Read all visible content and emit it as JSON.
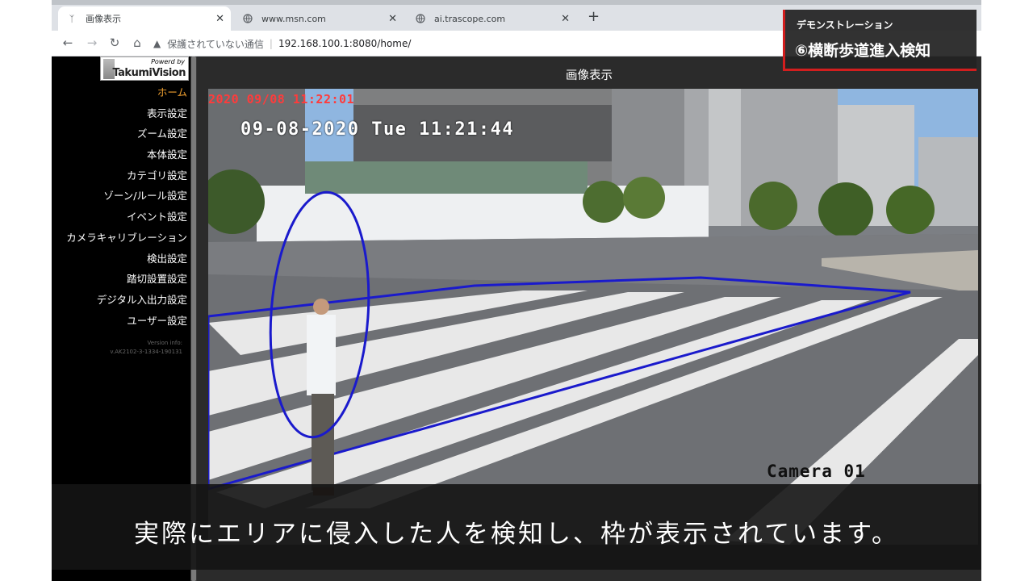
{
  "browser": {
    "tabs": [
      {
        "label": "画像表示",
        "active": true
      },
      {
        "label": "www.msn.com",
        "active": false
      },
      {
        "label": "ai.trascope.com",
        "active": false
      }
    ],
    "insecure_label": "保護されていない通信",
    "url": "192.168.100.1:8080/home/"
  },
  "logo": {
    "power": "Powerd by",
    "brand": "TakumiVision"
  },
  "sidebar": {
    "items": [
      {
        "label": "ホーム"
      },
      {
        "label": "表示設定"
      },
      {
        "label": "ズーム設定"
      },
      {
        "label": "本体設定"
      },
      {
        "label": "カテゴリ設定"
      },
      {
        "label": "ゾーン/ルール設定"
      },
      {
        "label": "イベント設定"
      },
      {
        "label": "カメラキャリブレーション"
      },
      {
        "label": "検出設定"
      },
      {
        "label": "踏切設置設定"
      },
      {
        "label": "デジタル入出力設定"
      },
      {
        "label": "ユーザー設定"
      }
    ],
    "version_label": "Version info:",
    "version_value": "v.AK2102-3-1334-190131"
  },
  "main": {
    "title": "画像表示",
    "osd_timestamp_red": "2020 09/08 11:22:01",
    "osd_timestamp_white": "09-08-2020 Tue 11:21:44",
    "osd_camera": "Camera 01"
  },
  "overlay": {
    "subtitle": "デモンストレーション",
    "title": "⑥横断歩道進入検知",
    "caption": "実際にエリアに侵入した人を検知し、枠が表示されています。"
  },
  "colors": {
    "accent_red": "#d21e1e",
    "active_menu": "#f0a030",
    "detection_outline": "#1a1acc"
  }
}
